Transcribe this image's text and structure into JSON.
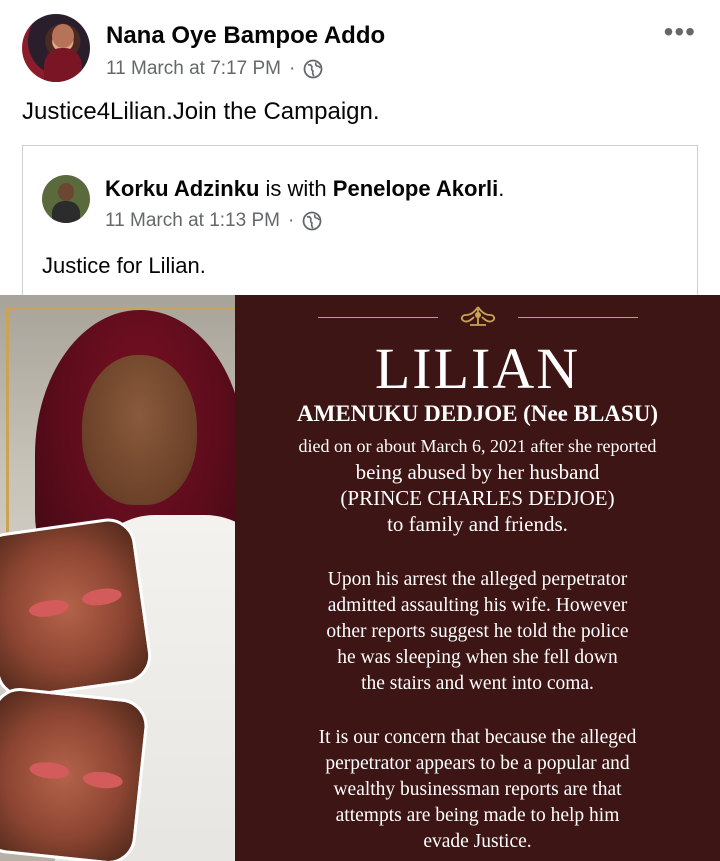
{
  "post": {
    "author": "Nana Oye Bampoe Addo",
    "timestamp": "11 March at 7:17 PM",
    "separator": "·",
    "text": "Justice4Lilian.Join the Campaign.",
    "more_label": "•••"
  },
  "shared": {
    "author": "Korku Adzinku",
    "with_text": " is with ",
    "tagged": "Penelope Akorli",
    "period": ".",
    "timestamp": "11 March at 1:13 PM",
    "separator": "·",
    "text": "Justice for Lilian."
  },
  "poster": {
    "title": "LILIAN",
    "subtitle": "AMENUKU DEDJOE (Nee BLASU)",
    "para1": [
      "died on or about March 6, 2021 after she reported",
      "being abused by her husband",
      "(PRINCE CHARLES DEDJOE)",
      "to family and friends."
    ],
    "para2": [
      "Upon his arrest the alleged perpetrator",
      "admitted assaulting his wife. However",
      "other reports suggest he told the police",
      "he was sleeping when she fell down",
      "the stairs and went into coma."
    ],
    "para3": [
      "It is our concern that because the alleged",
      "perpetrator appears to be a popular and",
      "wealthy businessman reports are that",
      "attempts are being made to help him",
      "evade Justice."
    ]
  },
  "icons": {
    "privacy": "globe-icon",
    "menu": "more-options-icon",
    "ornament": "flourish-icon"
  },
  "colors": {
    "panel_bg": "#3e1515",
    "gold": "#c9a453",
    "meta_text": "#65676b"
  }
}
